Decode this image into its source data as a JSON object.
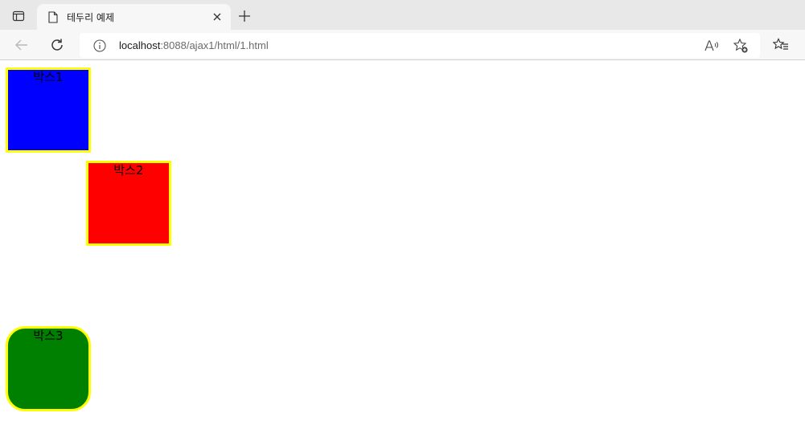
{
  "browser": {
    "tab": {
      "title": "테두리 예제"
    },
    "address_bar": {
      "host": "localhost",
      "path": ":8088/ajax1/html/1.html"
    },
    "icons": {
      "tab_actions": "tab-actions-icon",
      "favicon": "page-icon",
      "close": "close-icon",
      "new_tab": "plus-icon",
      "back": "back-arrow-icon",
      "reload": "reload-icon",
      "site_info": "info-icon",
      "read_aloud": "read-aloud-icon",
      "add_favorite": "add-favorite-icon",
      "favorites": "favorites-icon"
    }
  },
  "page": {
    "boxes": [
      {
        "label": "박스1",
        "background": "#0000ff",
        "border_color": "#000000",
        "border_style": "dotted"
      },
      {
        "label": "박스2",
        "background": "#ff0000",
        "border_color": "#ffff00",
        "border_style": "solid"
      },
      {
        "label": "박스3",
        "background": "#008000",
        "border_color": "#ffff00",
        "border_style": "solid rounded"
      }
    ]
  }
}
